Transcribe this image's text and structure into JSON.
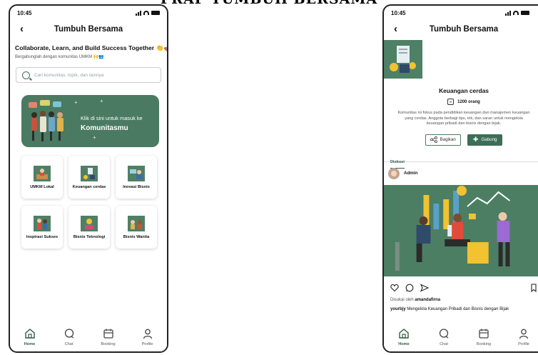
{
  "page_heading": "PRAP TUMBUH BERSAMA",
  "status": {
    "time": "10:45"
  },
  "header": {
    "back": "‹",
    "title": "Tumbuh Bersama"
  },
  "home": {
    "hero_title": "Collaborate, Learn, and Build Success Together 👏🚀",
    "hero_subtitle": "Bergabunglah dengan komunitas UMKM 🙌👥",
    "search_placeholder": "Cari komunitas, topik, dan lainnya",
    "banner_line1": "Klik di sini untuk masuk ke",
    "banner_line2": "Komunitasmu",
    "categories": [
      {
        "label": "UMKM Lokal",
        "icon": "umkm-icon"
      },
      {
        "label": "Keuangan cerdas",
        "icon": "finance-icon"
      },
      {
        "label": "Inovasi Bisnis",
        "icon": "innovation-icon"
      },
      {
        "label": "Inspirasi Sukses",
        "icon": "inspiration-icon"
      },
      {
        "label": "Bisnis Teknologi",
        "icon": "tech-icon"
      },
      {
        "label": "Bisnis Wanita",
        "icon": "women-icon"
      }
    ]
  },
  "nav": [
    {
      "label": "Home",
      "icon": "home-icon",
      "active": true
    },
    {
      "label": "Chat",
      "icon": "chat-icon",
      "active": false
    },
    {
      "label": "Booking",
      "icon": "calendar-icon",
      "active": false
    },
    {
      "label": "Profile",
      "icon": "profile-icon",
      "active": false
    }
  ],
  "community": {
    "name": "Keuangan cerdas",
    "members": "1200 orang",
    "description": "Komunitas ini fokus pada pendidikan keuangan dan manajemen keuangan yang cerdas. Anggota berbagi tips, trik, dan saran untuk mengelola keuangan pribadi dan bisnis dengan bijak.",
    "share_label": "Bagikan",
    "join_label": "Gabung",
    "tab_label": "Diskusi",
    "post": {
      "author": "Admin",
      "liked_prefix": "Disukai oleh",
      "liked_by": "amandafirna",
      "caption_user": "yourbjy",
      "caption_text": "Mengelola Keuangan Pribadi dan Bisnis dengan Bijak"
    }
  },
  "colors": {
    "primary": "#3d6e56",
    "banner": "#4a7a62",
    "accent_yellow": "#f2c230"
  }
}
